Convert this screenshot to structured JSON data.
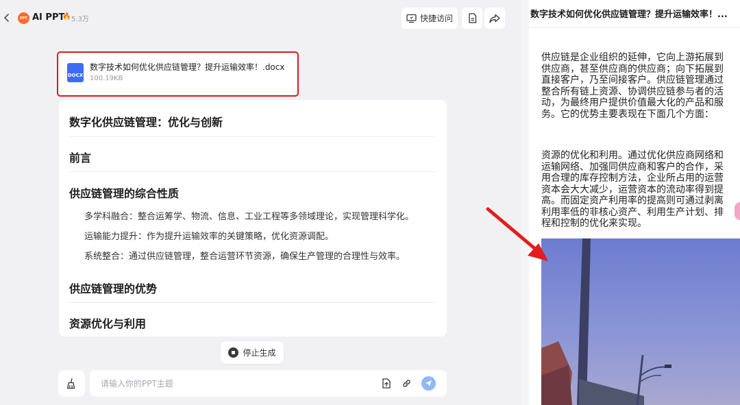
{
  "app": {
    "title": "AI PPT",
    "logo_text": "PPT",
    "hot_count": "5.3万",
    "brand_color": "#ff6a2b"
  },
  "toolbar": {
    "quick_access_label": "快捷访问",
    "icons": [
      "monitor-icon",
      "document-icon",
      "share-icon"
    ]
  },
  "file": {
    "type_label": "DOCX",
    "name": "数字技术如何优化供应链管理？提升运输效率！.docx",
    "size": "100.19KB",
    "highlight_color": "#e31a1a"
  },
  "outline": {
    "title": "数字化供应链管理：优化与创新",
    "sections": [
      {
        "heading": "前言",
        "items": []
      },
      {
        "heading": "供应链管理的综合性质",
        "items": [
          "多学科融合：整合运筹学、物流、信息、工业工程等多领域理论，实现管理科学化。",
          "运输能力提升：作为提升运输效率的关键策略，优化资源调配。",
          "系统整合：通过供应链管理，整合运营环节资源，确保生产管理的合理性与效率。"
        ]
      },
      {
        "heading": "供应链管理的优势",
        "items": []
      },
      {
        "heading": "资源优化与利用",
        "items": []
      }
    ]
  },
  "stop": {
    "label": "停止生成"
  },
  "input": {
    "placeholder": "请输入你的PPT主题",
    "send_color": "#8fb8f7"
  },
  "document": {
    "title": "数字技术如何优化供应链管理？提升运输效率！...",
    "paragraphs": [
      "供应链是企业组织的延伸，它向上游拓展到供应商，甚至供应商的供应商；向下拓展到直接客户，乃至间接客户。供应链管理通过整合所有链上资源、协调供应链参与者的活动，为最终用户提供价值最大化的产品和服务。它的优势主要表现在下面几个方面：",
      "资源的优化和利用。通过优化供应商网络和运输网络、加强同供应商和客户的合作，采用合理的库存控制方法，企业所占用的运营资本会大大减少，运营资本的流动率得到提高。而固定资产利用率的提高则可通过剥离利用率低的非核心资产、利用生产计划、排程和控制的优化来实现。"
    ]
  }
}
